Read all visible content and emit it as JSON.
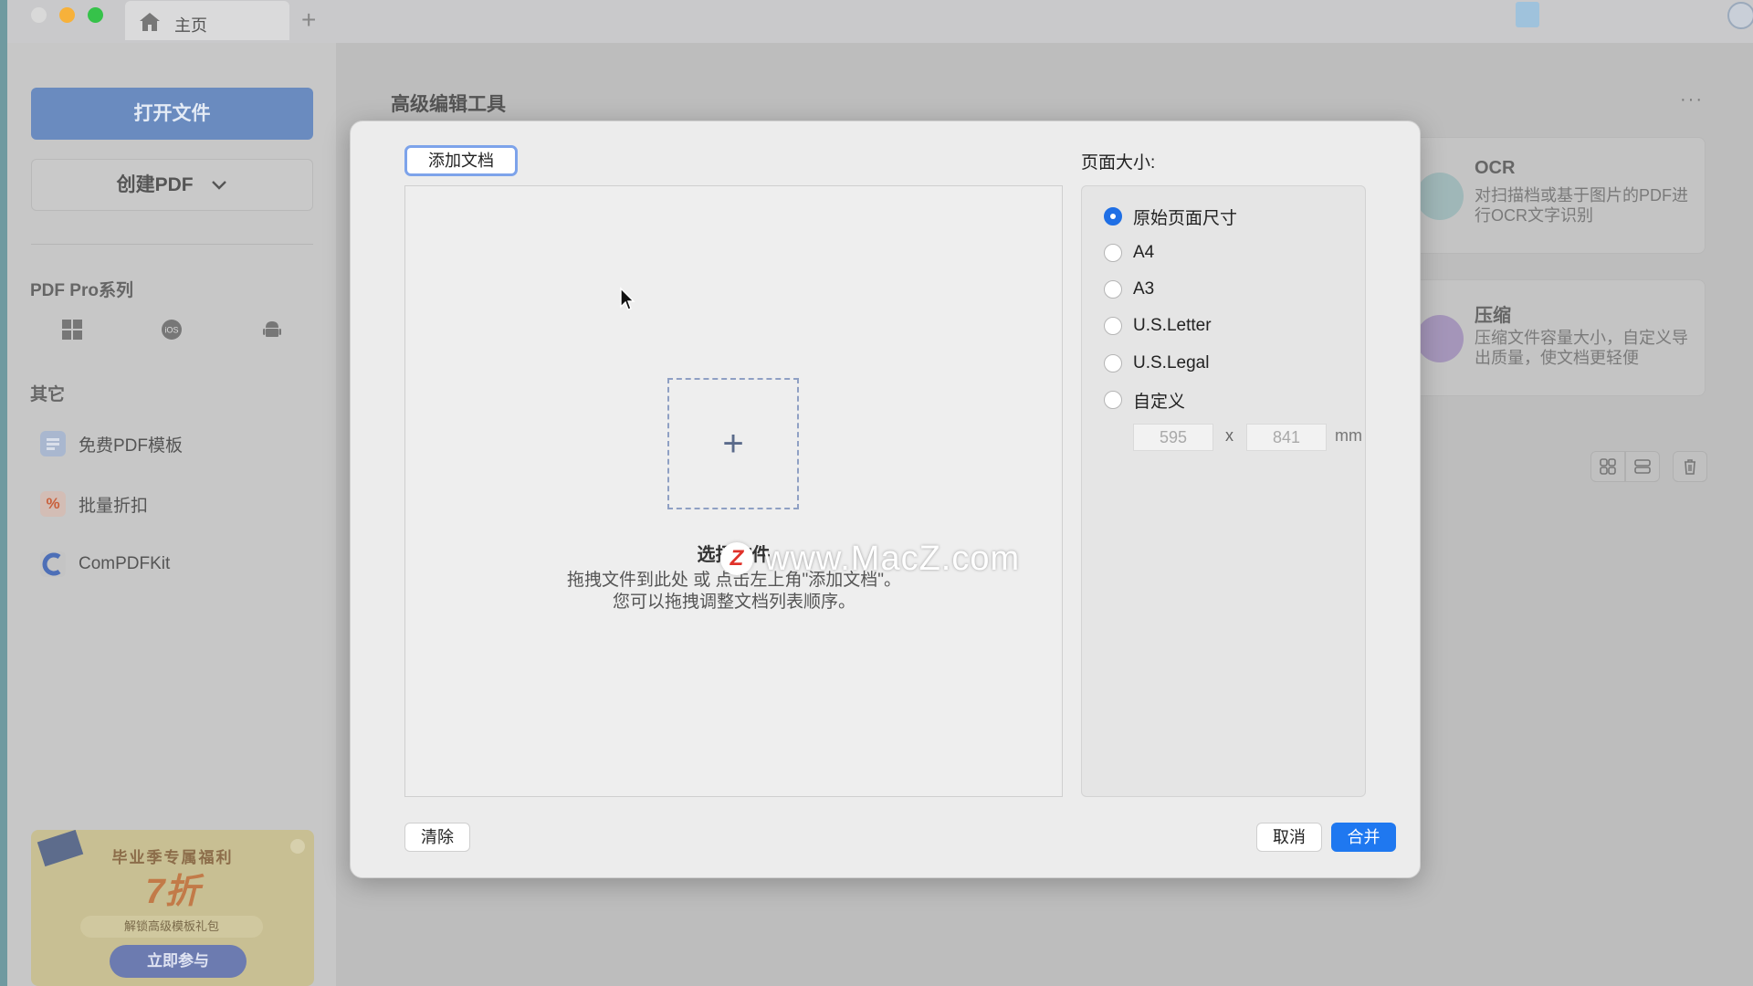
{
  "titlebar": {
    "tab_label": "主页"
  },
  "sidebar": {
    "open_label": "打开文件",
    "create_label": "创建PDF",
    "section_pro": "PDF Pro系列",
    "section_other": "其它",
    "items": [
      {
        "label": "免费PDF模板"
      },
      {
        "label": "批量折扣"
      },
      {
        "label": "ComPDFKit"
      }
    ],
    "promo": {
      "line1": "毕业季专属福利",
      "line2": "7折",
      "line3": "解锁高级模板礼包",
      "cta": "立即参与"
    }
  },
  "main": {
    "title": "高级编辑工具",
    "more": "···",
    "cards": [
      {
        "title": "OCR",
        "desc": "对扫描档或基于图片的PDF进行OCR文字识别"
      },
      {
        "title": "压缩",
        "desc": "压缩文件容量大小，自定义导出质量，使文档更轻便"
      }
    ]
  },
  "dialog": {
    "add_doc_label": "添加文档",
    "drop_title": "选择文件",
    "drop_hint": "拖拽文件到此处 或 点击左上角\"添加文档\"。您可以拖拽调整文档列表顺序。",
    "watermark": "www.MacZ.com",
    "watermark_logo": "Z",
    "page_size_label": "页面大小:",
    "options": [
      {
        "label": "原始页面尺寸",
        "selected": true
      },
      {
        "label": "A4",
        "selected": false
      },
      {
        "label": "A3",
        "selected": false
      },
      {
        "label": "U.S.Letter",
        "selected": false
      },
      {
        "label": "U.S.Legal",
        "selected": false
      },
      {
        "label": "自定义",
        "selected": false
      }
    ],
    "width_placeholder": "595",
    "height_placeholder": "841",
    "times": "x",
    "unit": "mm",
    "clear_label": "清除",
    "cancel_label": "取消",
    "merge_label": "合并"
  },
  "colors": {
    "accent": "#1f78f0",
    "sidebar_primary": "#6a8bbf"
  }
}
